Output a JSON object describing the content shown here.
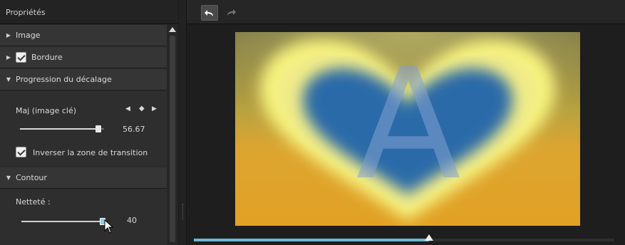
{
  "panel": {
    "title": "Propriétés",
    "sections": [
      {
        "label": "Image",
        "expanded": false
      },
      {
        "label": "Bordure",
        "expanded": false,
        "checked": true
      },
      {
        "label": "Progression du décalage",
        "expanded": true
      },
      {
        "label": "Contour",
        "expanded": true
      }
    ],
    "keyframe": {
      "label": "Maj (image clé)",
      "value": "56.67",
      "level_percent": 56.67
    },
    "invert": {
      "label": "Inverser la zone de transition",
      "checked": true
    },
    "sharpness": {
      "label": "Netteté :",
      "value": "40",
      "level_percent": 40
    }
  },
  "toolbar": {
    "undo_icon": "undo-icon",
    "redo_icon": "redo-icon"
  },
  "preview": {
    "letter": "A",
    "timeline_percent": 56,
    "colors": {
      "heart": "#2a6aa8",
      "glow": "#f4f07a",
      "background_bottom": "#e2a124",
      "timeline": "#6fb6cf"
    }
  }
}
